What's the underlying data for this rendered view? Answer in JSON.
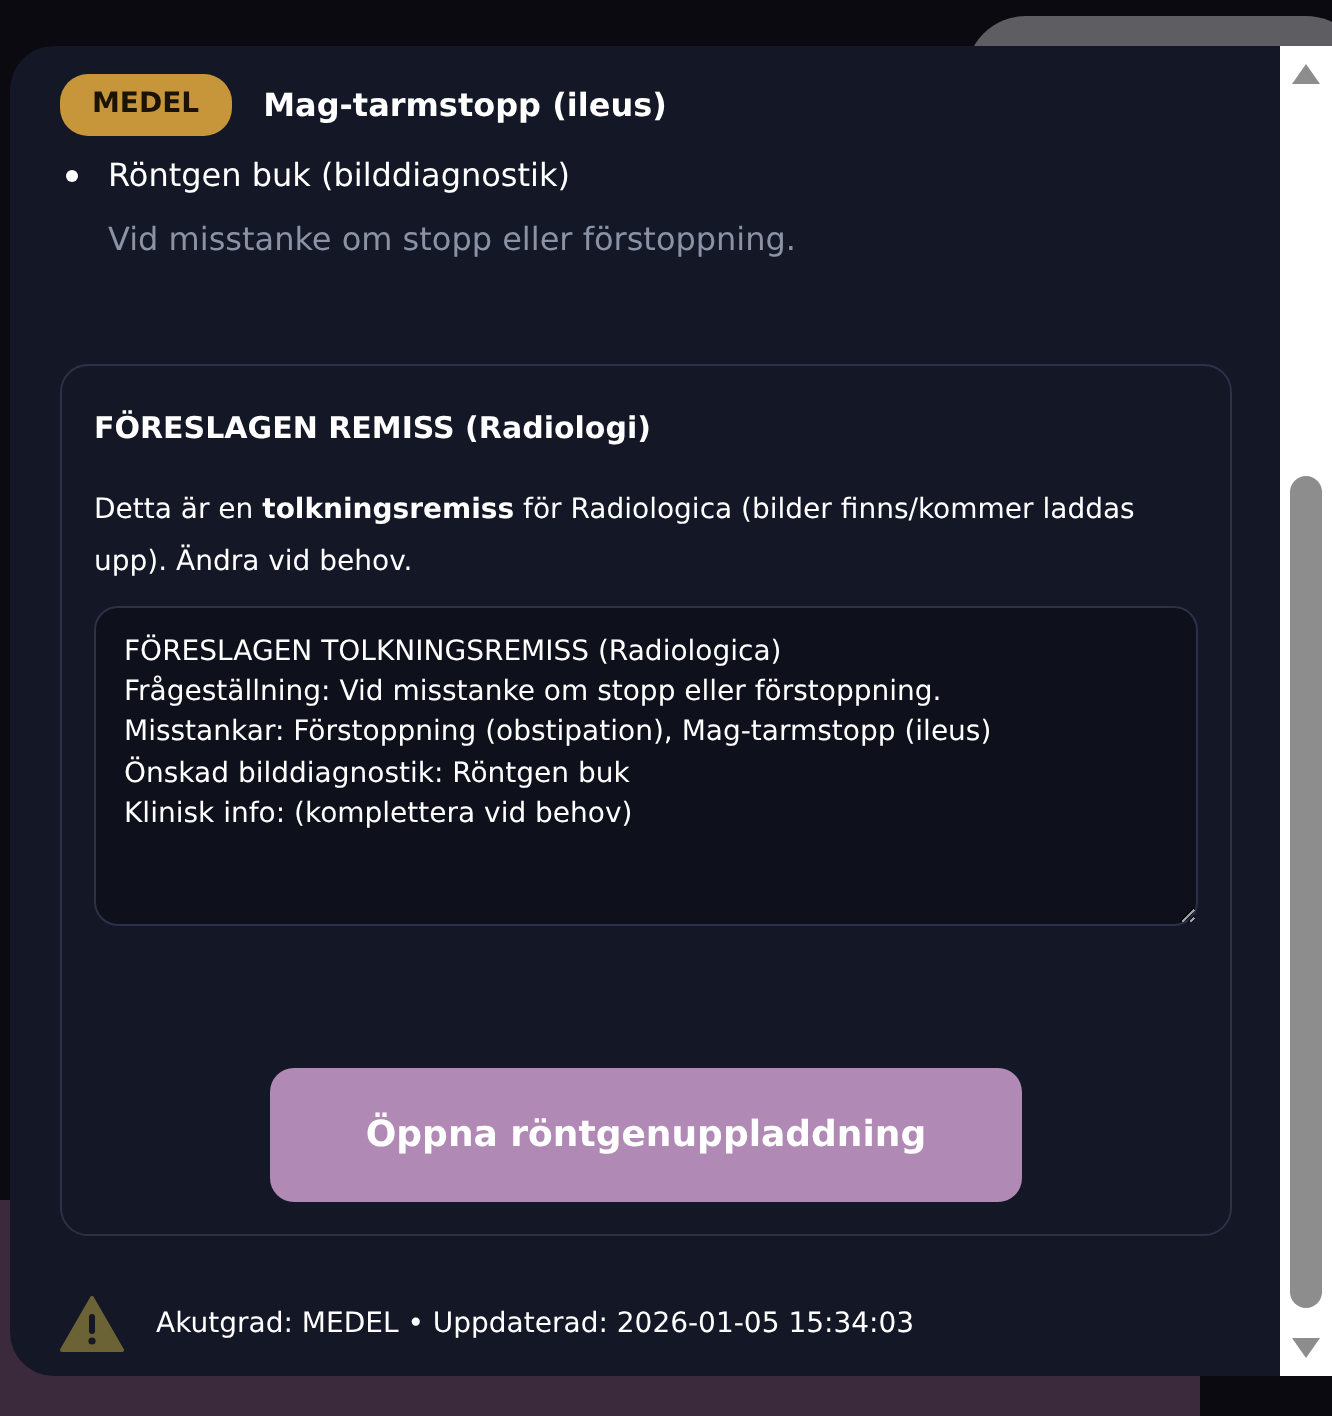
{
  "finding": {
    "badge": "MEDEL",
    "title": "Mag-tarmstopp (ileus)",
    "items": [
      {
        "text": "Röntgen buk (bilddiagnostik)",
        "note": "Vid misstanke om stopp eller förstoppning."
      }
    ]
  },
  "referral": {
    "title": "FÖRESLAGEN REMISS (Radiologi)",
    "description": "Detta är en **tolkningsremiss** för Radiologica (bilder finns/kommer laddas upp). Ändra vid behov.",
    "text": "FÖRESLAGEN TOLKNINGSREMISS (Radiologica)\nFrågeställning: Vid misstanke om stopp eller förstoppning.\nMisstankar: Förstoppning (obstipation), Mag-tarmstopp (ileus)\nÖnskad bilddiagnostik: Röntgen buk\nKlinisk info: (komplettera vid behov)",
    "button": "Öppna röntgenuppladdning"
  },
  "status_bar": {
    "text": "Akutgrad: MEDEL • Uppdaterad: 2026-01-05 15:34:03"
  }
}
